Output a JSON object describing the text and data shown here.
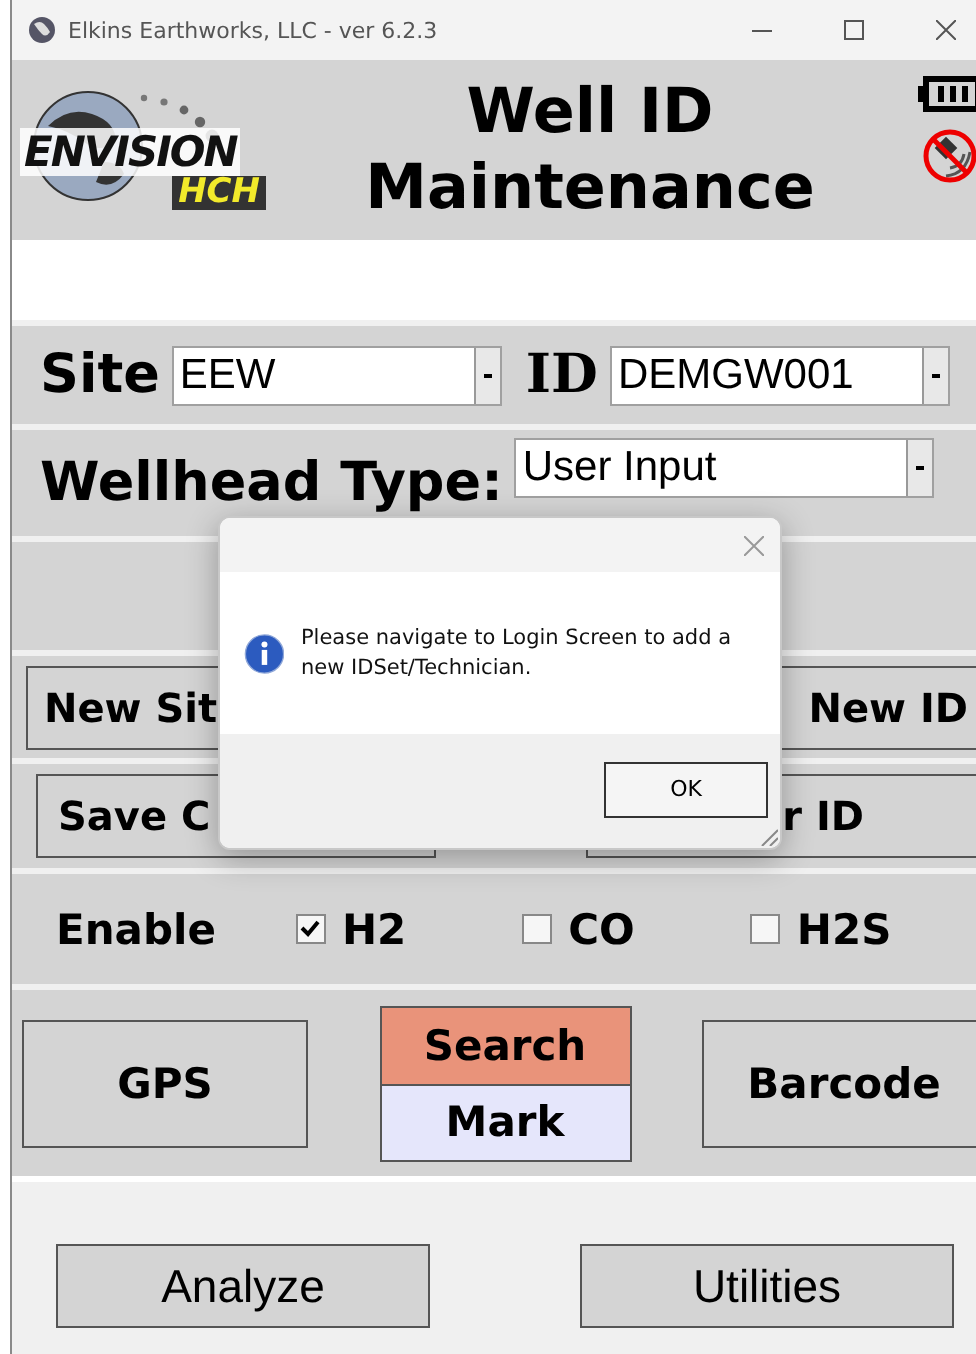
{
  "window": {
    "title": "Elkins Earthworks, LLC - ver 6.2.3"
  },
  "header": {
    "logo_text": "ENVISION",
    "logo_subtext": "HCH",
    "title": "Well ID Maintenance"
  },
  "site": {
    "label": "Site",
    "value": "EEW"
  },
  "id": {
    "label": "ID",
    "value": "DEMGW001"
  },
  "wellhead": {
    "label": "Wellhead Type:",
    "value": "User Input"
  },
  "button_rows": [
    {
      "left": "New Sit",
      "right": "New ID"
    },
    {
      "left": "Save C",
      "right": "r ID"
    }
  ],
  "enable": {
    "label": "Enable",
    "gases": [
      {
        "label": "H2",
        "checked": true
      },
      {
        "label": "CO",
        "checked": false
      },
      {
        "label": "H2S",
        "checked": false
      }
    ]
  },
  "locate": {
    "gps": "GPS",
    "search": "Search",
    "mark": "Mark",
    "barcode": "Barcode"
  },
  "bottom_buttons": [
    "Analyze",
    "Utilities"
  ],
  "dialog": {
    "message": "Please navigate to Login Screen to add a new IDSet/Technician.",
    "button": "OK"
  }
}
